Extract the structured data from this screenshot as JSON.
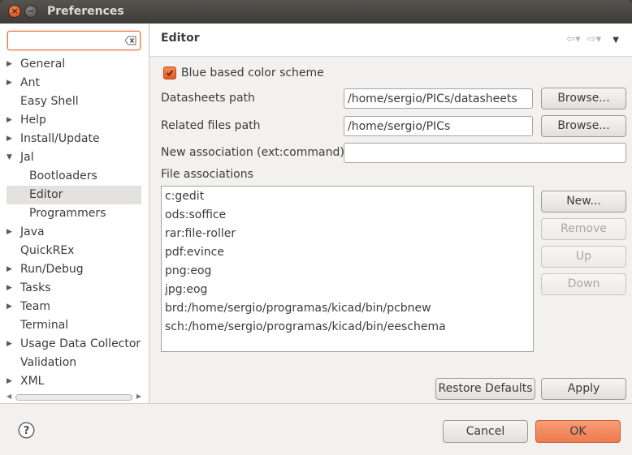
{
  "window": {
    "title": "Preferences",
    "close_glyph": "×",
    "minimize_glyph": "−"
  },
  "filter": {
    "value": "",
    "placeholder": ""
  },
  "tree": [
    {
      "label": "General",
      "expandable": true,
      "arrow": "▶"
    },
    {
      "label": "Ant",
      "expandable": true,
      "arrow": "▶"
    },
    {
      "label": "Easy Shell",
      "expandable": false,
      "arrow": ""
    },
    {
      "label": "Help",
      "expandable": true,
      "arrow": "▶"
    },
    {
      "label": "Install/Update",
      "expandable": true,
      "arrow": "▶"
    },
    {
      "label": "Jal",
      "expandable": true,
      "expanded": true,
      "arrow": "▼"
    },
    {
      "label": "Bootloaders",
      "level": 1
    },
    {
      "label": "Editor",
      "level": 1,
      "selected": true
    },
    {
      "label": "Programmers",
      "level": 1
    },
    {
      "label": "Java",
      "expandable": true,
      "arrow": "▶"
    },
    {
      "label": "QuickREx",
      "expandable": false,
      "arrow": ""
    },
    {
      "label": "Run/Debug",
      "expandable": true,
      "arrow": "▶"
    },
    {
      "label": "Tasks",
      "expandable": true,
      "arrow": "▶"
    },
    {
      "label": "Team",
      "expandable": true,
      "arrow": "▶"
    },
    {
      "label": "Terminal",
      "expandable": false,
      "arrow": ""
    },
    {
      "label": "Usage Data Collector",
      "expandable": true,
      "arrow": "▶"
    },
    {
      "label": "Validation",
      "expandable": false,
      "arrow": ""
    },
    {
      "label": "XML",
      "expandable": true,
      "arrow": "▶"
    }
  ],
  "scroll_arrows": {
    "left": "◀",
    "right": "▶"
  },
  "page": {
    "title": "Editor",
    "nav_back": "⇦▾",
    "nav_forward": "⇨▾",
    "menu": "▼"
  },
  "editor": {
    "color_scheme_label": "Blue based color scheme",
    "color_scheme_checked": true,
    "datasheets_label": "Datasheets path",
    "datasheets_value": "/home/sergio/PICs/datasheets",
    "related_label": "Related files path",
    "related_value": "/home/sergio/PICs",
    "association_label": "New association (ext:command)",
    "association_value": "",
    "file_assoc_label": "File associations",
    "browse_label": "Browse...",
    "new_label": "New...",
    "remove_label": "Remove",
    "up_label": "Up",
    "down_label": "Down",
    "associations": [
      "c:gedit",
      "ods:soffice",
      "rar:file-roller",
      "pdf:evince",
      "png:eog",
      "jpg:eog",
      "brd:/home/sergio/programas/kicad/bin/pcbnew",
      "sch:/home/sergio/programas/kicad/bin/eeschema"
    ],
    "restore_defaults_label": "Restore Defaults",
    "apply_label": "Apply"
  },
  "footer": {
    "help_glyph": "?",
    "cancel_label": "Cancel",
    "ok_label": "OK"
  },
  "colors": {
    "accent": "#e9683a",
    "title_bar": "#3c3b37",
    "window_bg": "#f2f1f0",
    "selection": "#e3e2df"
  }
}
